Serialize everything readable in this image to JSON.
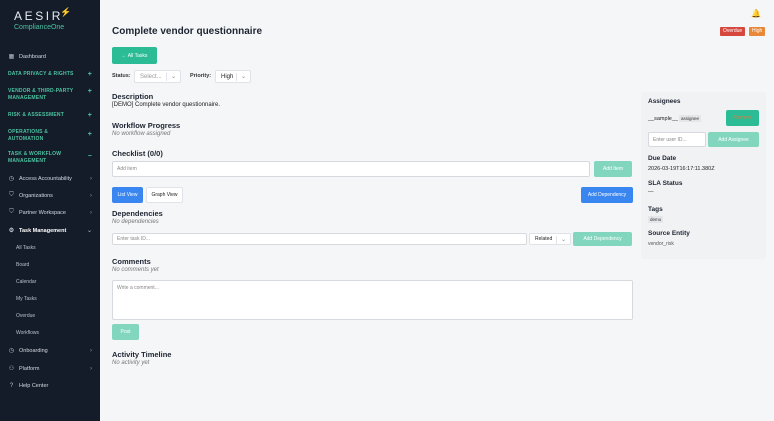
{
  "brand": {
    "name": "AESIR",
    "sub": "ComplianceOne"
  },
  "sidebar": {
    "dashboard": "Dashboard",
    "sections": [
      {
        "label": "DATA PRIVACY & RIGHTS"
      },
      {
        "label": "VENDOR & THIRD-PARTY MANAGEMENT"
      },
      {
        "label": "RISK & ASSESSMENT"
      },
      {
        "label": "OPERATIONS & AUTOMATION"
      },
      {
        "label": "TASK & WORKFLOW MANAGEMENT"
      }
    ],
    "items": [
      {
        "label": "Access Accountability"
      },
      {
        "label": "Organizations"
      },
      {
        "label": "Partner Workspace"
      },
      {
        "label": "Task Management"
      }
    ],
    "subitems": [
      "All Tasks",
      "Board",
      "Calendar",
      "My Tasks",
      "Overdue",
      "Workflows"
    ],
    "bottom": [
      {
        "label": "Onboarding"
      },
      {
        "label": "Platform"
      },
      {
        "label": "Help Center"
      }
    ]
  },
  "page": {
    "title": "Complete vendor questionnaire",
    "badges": {
      "overdue": "Overdue",
      "high": "High"
    },
    "all_tasks_button": "← All Tasks",
    "status_label": "Status:",
    "status_placeholder": "Select...",
    "priority_label": "Priority:",
    "priority_value": "High"
  },
  "description": {
    "heading": "Description",
    "text": "[DEMO] Complete vendor questionnaire."
  },
  "workflow": {
    "heading": "Workflow Progress",
    "empty": "No workflow assigned"
  },
  "checklist": {
    "heading": "Checklist (0/0)",
    "placeholder": "Add item",
    "add_button": "Add Item"
  },
  "views": {
    "list": "List View",
    "graph": "Graph View",
    "add_dependency": "Add Dependency"
  },
  "dependencies": {
    "heading": "Dependencies",
    "empty": "No dependencies",
    "input_placeholder": "Enter task ID...",
    "type_value": "Related",
    "add_button": "Add Dependency"
  },
  "comments": {
    "heading": "Comments",
    "empty": "No comments yet",
    "placeholder": "Write a comment...",
    "post_button": "Post"
  },
  "activity": {
    "heading": "Activity Timeline",
    "empty": "No activity yet"
  },
  "panel": {
    "assignees_heading": "Assignees",
    "assignee_name": "__sample__",
    "assignee_role": "assignee",
    "remove_button": "Remove",
    "user_id_placeholder": "Enter user ID...",
    "add_assignee_button": "Add Assignee",
    "due_date_heading": "Due Date",
    "due_date_value": "2026-03-19T16:17:11.380Z",
    "sla_heading": "SLA Status",
    "sla_value": "—",
    "tags_heading": "Tags",
    "tag": "demo",
    "source_heading": "Source Entity",
    "source_value": "vendor_risk"
  },
  "colors": {
    "sidebar_bg": "#141c29",
    "accent_teal": "#2bbc95",
    "accent_blue": "#3a86f0",
    "overdue_red": "#d6473d",
    "high_orange": "#e8893a"
  }
}
